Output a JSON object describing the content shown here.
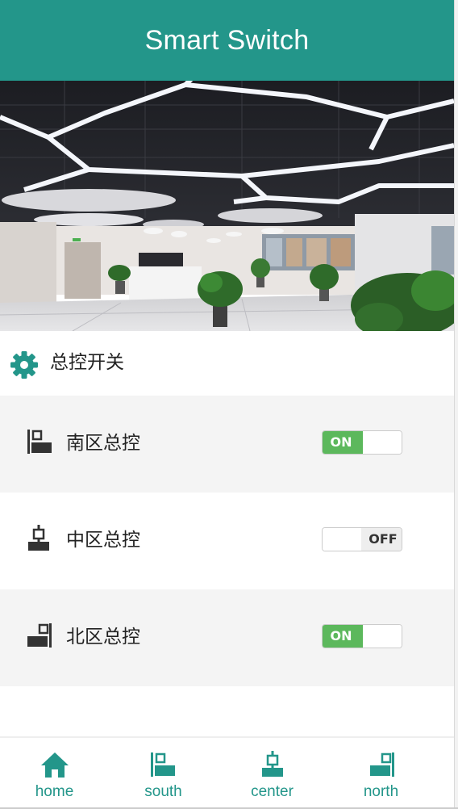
{
  "header": {
    "title": "Smart Switch"
  },
  "banner": {
    "image": "office-ceiling-lights-photo"
  },
  "master": {
    "icon": "gear-icon",
    "label": "总控开关"
  },
  "zones": [
    {
      "icon": "south-zone-icon",
      "label": "南区总控",
      "state": "ON"
    },
    {
      "icon": "center-zone-icon",
      "label": "中区总控",
      "state": "OFF"
    },
    {
      "icon": "north-zone-icon",
      "label": "北区总控",
      "state": "ON"
    }
  ],
  "tabs": [
    {
      "icon": "home-icon",
      "label": "home"
    },
    {
      "icon": "south-zone-icon",
      "label": "south"
    },
    {
      "icon": "center-zone-icon",
      "label": "center"
    },
    {
      "icon": "north-zone-icon",
      "label": "north"
    }
  ],
  "colors": {
    "brand": "#23968a",
    "toggle_on": "#5cb85c",
    "icon_dark": "#333333"
  }
}
